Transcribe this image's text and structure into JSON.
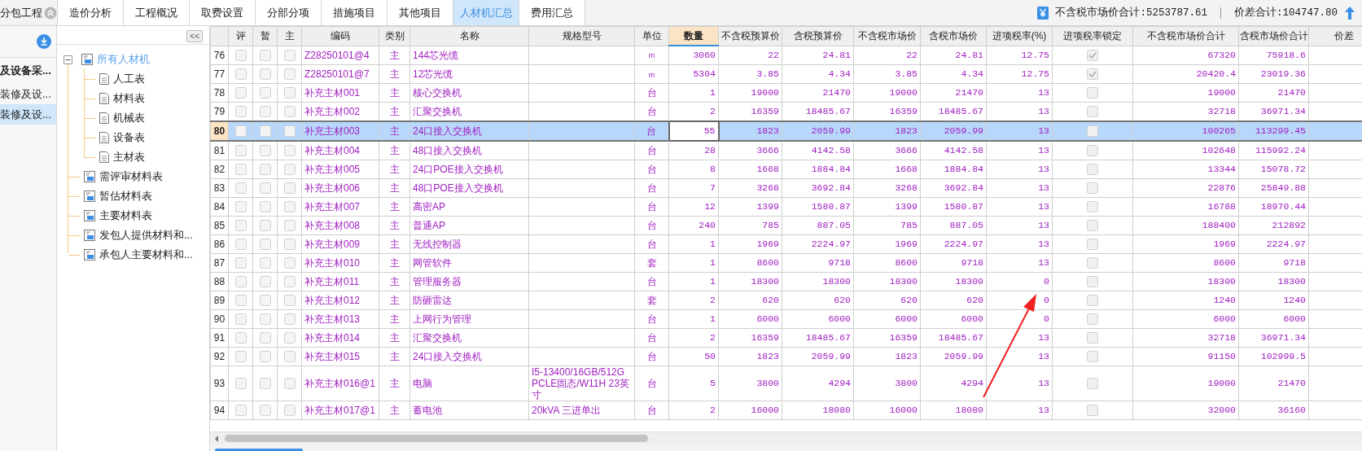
{
  "header": {
    "project": "分包工程",
    "tabs": [
      {
        "label": "造价分析",
        "selected": false
      },
      {
        "label": "工程概况",
        "selected": false
      },
      {
        "label": "取费设置",
        "selected": false
      },
      {
        "label": "分部分项",
        "selected": false
      },
      {
        "label": "措施项目",
        "selected": false
      },
      {
        "label": "其他项目",
        "selected": false
      },
      {
        "label": "人材机汇总",
        "selected": true
      },
      {
        "label": "费用汇总",
        "selected": false
      }
    ],
    "totals": [
      "不含税市场价合计:5253787.61",
      "价差合计:104747.80"
    ]
  },
  "project_list": [
    {
      "label": "及设备采...",
      "kind": "group",
      "selected": false
    },
    {
      "label": "装修及设...",
      "kind": "item",
      "selected": false
    },
    {
      "label": "装修及设...",
      "kind": "item",
      "selected": true
    }
  ],
  "tree": [
    {
      "label": "所有人材机",
      "selected": true,
      "expanded": true,
      "children": [
        {
          "label": "人工表",
          "selected": false
        },
        {
          "label": "材料表",
          "selected": false
        },
        {
          "label": "机械表",
          "selected": false
        },
        {
          "label": "设备表",
          "selected": false
        },
        {
          "label": "主材表",
          "selected": false
        }
      ]
    },
    {
      "label": "需评审材料表",
      "selected": false
    },
    {
      "label": "暂估材料表",
      "selected": false
    },
    {
      "label": "主要材料表",
      "selected": false
    },
    {
      "label": "发包人提供材料和...",
      "selected": false
    },
    {
      "label": "承包人主要材料和...",
      "selected": false
    }
  ],
  "table": {
    "collapse_button": "<<",
    "columns": [
      {
        "label": "评",
        "kind": "check",
        "selected": false
      },
      {
        "label": "暂",
        "kind": "check",
        "selected": false
      },
      {
        "label": "主",
        "kind": "check",
        "selected": false
      },
      {
        "label": "编码",
        "kind": "text",
        "selected": false
      },
      {
        "label": "类别",
        "kind": "center",
        "selected": false
      },
      {
        "label": "名称",
        "kind": "text",
        "selected": false
      },
      {
        "label": "规格型号",
        "kind": "text",
        "selected": false
      },
      {
        "label": "单位",
        "kind": "center",
        "selected": false
      },
      {
        "label": "数量",
        "kind": "num",
        "selected": true
      },
      {
        "label": "不含税预算价",
        "kind": "num",
        "selected": false
      },
      {
        "label": "含税预算价",
        "kind": "num",
        "selected": false
      },
      {
        "label": "不含税市场价",
        "kind": "num",
        "selected": false
      },
      {
        "label": "含税市场价",
        "kind": "num",
        "selected": false
      },
      {
        "label": "进项税率(%)",
        "kind": "num",
        "selected": false
      },
      {
        "label": "进项税率锁定",
        "kind": "lock",
        "selected": false
      },
      {
        "label": "不含税市场价合计",
        "kind": "num",
        "selected": false
      },
      {
        "label": "含税市场价合计",
        "kind": "num",
        "selected": false
      },
      {
        "label": "价差",
        "kind": "blank",
        "selected": false
      }
    ],
    "rows": [
      {
        "no": "76",
        "selected": false,
        "checks": [
          false,
          false,
          false
        ],
        "locked": true,
        "cells": [
          "",
          "",
          "",
          "Z28250101@4",
          "主",
          "144芯光缆",
          "",
          "m",
          "3060",
          "22",
          "24.81",
          "22",
          "24.81",
          "12.75",
          "",
          "67320",
          "75918.6"
        ]
      },
      {
        "no": "77",
        "selected": false,
        "checks": [
          false,
          false,
          false
        ],
        "locked": true,
        "cells": [
          "",
          "",
          "",
          "Z28250101@7",
          "主",
          "12芯光缆",
          "",
          "m",
          "5304",
          "3.85",
          "4.34",
          "3.85",
          "4.34",
          "12.75",
          "",
          "20420.4",
          "23019.36"
        ]
      },
      {
        "no": "78",
        "selected": false,
        "checks": [
          false,
          false,
          false
        ],
        "locked": false,
        "cells": [
          "",
          "",
          "",
          "补充主材001",
          "主",
          "核心交换机",
          "",
          "台",
          "1",
          "19000",
          "21470",
          "19000",
          "21470",
          "13",
          "",
          "19000",
          "21470"
        ]
      },
      {
        "no": "79",
        "selected": false,
        "checks": [
          false,
          false,
          false
        ],
        "locked": false,
        "cells": [
          "",
          "",
          "",
          "补充主材002",
          "主",
          "汇聚交换机",
          "",
          "台",
          "2",
          "16359",
          "18485.67",
          "16359",
          "18485.67",
          "13",
          "",
          "32718",
          "36971.34"
        ]
      },
      {
        "no": "80",
        "selected": true,
        "checks": [
          false,
          false,
          false
        ],
        "locked": false,
        "cells": [
          "",
          "",
          "",
          "补充主材003",
          "主",
          "24口接入交换机",
          "",
          "台",
          "55",
          "1823",
          "2059.99",
          "1823",
          "2059.99",
          "13",
          "",
          "100265",
          "113299.45"
        ]
      },
      {
        "no": "81",
        "selected": false,
        "checks": [
          false,
          false,
          false
        ],
        "locked": false,
        "cells": [
          "",
          "",
          "",
          "补充主材004",
          "主",
          "48口接入交换机",
          "",
          "台",
          "28",
          "3666",
          "4142.58",
          "3666",
          "4142.58",
          "13",
          "",
          "102648",
          "115992.24"
        ]
      },
      {
        "no": "82",
        "selected": false,
        "checks": [
          false,
          false,
          false
        ],
        "locked": false,
        "cells": [
          "",
          "",
          "",
          "补充主材005",
          "主",
          "24口POE接入交换机",
          "",
          "台",
          "8",
          "1668",
          "1884.84",
          "1668",
          "1884.84",
          "13",
          "",
          "13344",
          "15078.72"
        ]
      },
      {
        "no": "83",
        "selected": false,
        "checks": [
          false,
          false,
          false
        ],
        "locked": false,
        "cells": [
          "",
          "",
          "",
          "补充主材006",
          "主",
          "48口POE接入交换机",
          "",
          "台",
          "7",
          "3268",
          "3692.84",
          "3268",
          "3692.84",
          "13",
          "",
          "22876",
          "25849.88"
        ]
      },
      {
        "no": "84",
        "selected": false,
        "checks": [
          false,
          false,
          false
        ],
        "locked": false,
        "cells": [
          "",
          "",
          "",
          "补充主材007",
          "主",
          "高密AP",
          "",
          "台",
          "12",
          "1399",
          "1580.87",
          "1399",
          "1580.87",
          "13",
          "",
          "16788",
          "18970.44"
        ]
      },
      {
        "no": "85",
        "selected": false,
        "checks": [
          false,
          false,
          false
        ],
        "locked": false,
        "cells": [
          "",
          "",
          "",
          "补充主材008",
          "主",
          "普通AP",
          "",
          "台",
          "240",
          "785",
          "887.05",
          "785",
          "887.05",
          "13",
          "",
          "188400",
          "212892"
        ]
      },
      {
        "no": "86",
        "selected": false,
        "checks": [
          false,
          false,
          false
        ],
        "locked": false,
        "cells": [
          "",
          "",
          "",
          "补充主材009",
          "主",
          "无线控制器",
          "",
          "台",
          "1",
          "1969",
          "2224.97",
          "1969",
          "2224.97",
          "13",
          "",
          "1969",
          "2224.97"
        ]
      },
      {
        "no": "87",
        "selected": false,
        "checks": [
          false,
          false,
          false
        ],
        "locked": false,
        "cells": [
          "",
          "",
          "",
          "补充主材010",
          "主",
          "网管软件",
          "",
          "套",
          "1",
          "8600",
          "9718",
          "8600",
          "9718",
          "13",
          "",
          "8600",
          "9718"
        ]
      },
      {
        "no": "88",
        "selected": false,
        "checks": [
          false,
          false,
          false
        ],
        "locked": false,
        "cells": [
          "",
          "",
          "",
          "补充主材011",
          "主",
          "管理服务器",
          "",
          "台",
          "1",
          "18300",
          "18300",
          "18300",
          "18300",
          "0",
          "",
          "18300",
          "18300"
        ]
      },
      {
        "no": "89",
        "selected": false,
        "checks": [
          false,
          false,
          false
        ],
        "locked": false,
        "cells": [
          "",
          "",
          "",
          "补充主材012",
          "主",
          "防砸雷达",
          "",
          "套",
          "2",
          "620",
          "620",
          "620",
          "620",
          "0",
          "",
          "1240",
          "1240"
        ]
      },
      {
        "no": "90",
        "selected": false,
        "checks": [
          false,
          false,
          false
        ],
        "locked": false,
        "cells": [
          "",
          "",
          "",
          "补充主材013",
          "主",
          "上网行为管理",
          "",
          "台",
          "1",
          "6000",
          "6000",
          "6000",
          "6000",
          "0",
          "",
          "6000",
          "6000"
        ]
      },
      {
        "no": "91",
        "selected": false,
        "checks": [
          false,
          false,
          false
        ],
        "locked": false,
        "cells": [
          "",
          "",
          "",
          "补充主材014",
          "主",
          "汇聚交换机",
          "",
          "台",
          "2",
          "16359",
          "18485.67",
          "16359",
          "18485.67",
          "13",
          "",
          "32718",
          "36971.34"
        ]
      },
      {
        "no": "92",
        "selected": false,
        "checks": [
          false,
          false,
          false
        ],
        "locked": false,
        "cells": [
          "",
          "",
          "",
          "补充主材015",
          "主",
          "24口接入交换机",
          "",
          "台",
          "50",
          "1823",
          "2059.99",
          "1823",
          "2059.99",
          "13",
          "",
          "91150",
          "102999.5"
        ]
      },
      {
        "no": "93",
        "selected": false,
        "checks": [
          false,
          false,
          false
        ],
        "locked": false,
        "cells": [
          "",
          "",
          "",
          "补充主材016@1",
          "主",
          "电脑",
          "I5-13400/16GB/512G PCLE固态/W11H 23英寸",
          "台",
          "5",
          "3800",
          "4294",
          "3800",
          "4294",
          "13",
          "",
          "19000",
          "21470"
        ]
      },
      {
        "no": "94",
        "selected": false,
        "checks": [
          false,
          false,
          false
        ],
        "locked": false,
        "cells": [
          "",
          "",
          "",
          "补充主材017@1",
          "主",
          "蓄电池",
          "20kVA  三进单出",
          "台",
          "2",
          "16000",
          "18080",
          "16000",
          "18080",
          "13",
          "",
          "32000",
          "36160"
        ]
      }
    ]
  }
}
